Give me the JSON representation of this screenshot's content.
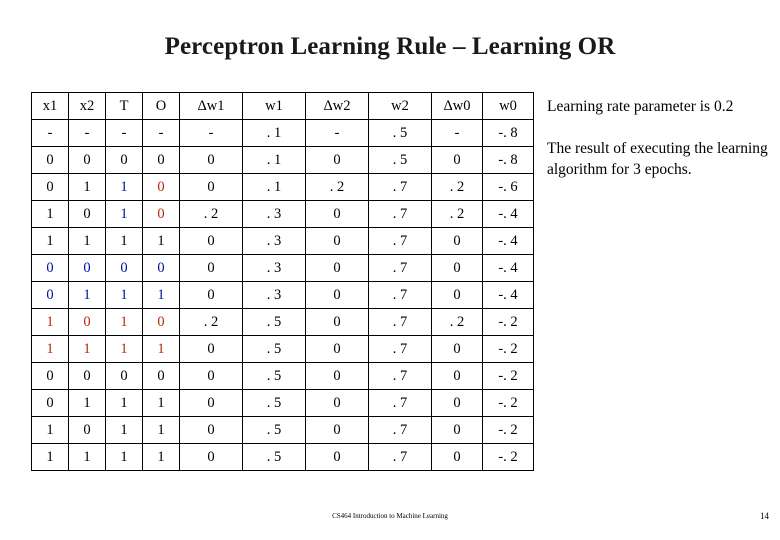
{
  "slide": {
    "title": "Perceptron Learning Rule – Learning OR",
    "footer_center": "CS464 Introduction to Machine Learning",
    "footer_page": "14"
  },
  "table": {
    "headers": [
      {
        "text": "x1",
        "color": "black"
      },
      {
        "text": "x2",
        "color": "black"
      },
      {
        "text": "T",
        "color": "black"
      },
      {
        "text": "O",
        "color": "black"
      },
      {
        "text": "Δw1",
        "color": "black"
      },
      {
        "text": "w1",
        "color": "black"
      },
      {
        "text": "Δw2",
        "color": "black"
      },
      {
        "text": "w2",
        "color": "black"
      },
      {
        "text": "Δw0",
        "color": "black"
      },
      {
        "text": "w0",
        "color": "black"
      }
    ],
    "rows": [
      [
        {
          "text": "-",
          "color": "black"
        },
        {
          "text": "-",
          "color": "black"
        },
        {
          "text": "-",
          "color": "black"
        },
        {
          "text": "-",
          "color": "black"
        },
        {
          "text": "-",
          "color": "black"
        },
        {
          "text": ". 1",
          "color": "black"
        },
        {
          "text": "-",
          "color": "black"
        },
        {
          "text": ". 5",
          "color": "black"
        },
        {
          "text": "-",
          "color": "black"
        },
        {
          "text": "-. 8",
          "color": "black"
        }
      ],
      [
        {
          "text": "0",
          "color": "black"
        },
        {
          "text": "0",
          "color": "black"
        },
        {
          "text": "0",
          "color": "black"
        },
        {
          "text": "0",
          "color": "black"
        },
        {
          "text": "0",
          "color": "black"
        },
        {
          "text": ". 1",
          "color": "black"
        },
        {
          "text": "0",
          "color": "black"
        },
        {
          "text": ". 5",
          "color": "black"
        },
        {
          "text": "0",
          "color": "black"
        },
        {
          "text": "-. 8",
          "color": "black"
        }
      ],
      [
        {
          "text": "0",
          "color": "black"
        },
        {
          "text": "1",
          "color": "black"
        },
        {
          "text": "1",
          "color": "blue"
        },
        {
          "text": "0",
          "color": "red"
        },
        {
          "text": "0",
          "color": "black"
        },
        {
          "text": ". 1",
          "color": "black"
        },
        {
          "text": ". 2",
          "color": "black"
        },
        {
          "text": ". 7",
          "color": "black"
        },
        {
          "text": ". 2",
          "color": "black"
        },
        {
          "text": "-. 6",
          "color": "black"
        }
      ],
      [
        {
          "text": "1",
          "color": "black"
        },
        {
          "text": "0",
          "color": "black"
        },
        {
          "text": "1",
          "color": "blue"
        },
        {
          "text": "0",
          "color": "red"
        },
        {
          "text": ". 2",
          "color": "black"
        },
        {
          "text": ". 3",
          "color": "black"
        },
        {
          "text": "0",
          "color": "black"
        },
        {
          "text": ". 7",
          "color": "black"
        },
        {
          "text": ". 2",
          "color": "black"
        },
        {
          "text": "-. 4",
          "color": "black"
        }
      ],
      [
        {
          "text": "1",
          "color": "black"
        },
        {
          "text": "1",
          "color": "black"
        },
        {
          "text": "1",
          "color": "black"
        },
        {
          "text": "1",
          "color": "black"
        },
        {
          "text": "0",
          "color": "black"
        },
        {
          "text": ". 3",
          "color": "black"
        },
        {
          "text": "0",
          "color": "black"
        },
        {
          "text": ". 7",
          "color": "black"
        },
        {
          "text": "0",
          "color": "black"
        },
        {
          "text": "-. 4",
          "color": "black"
        }
      ],
      [
        {
          "text": "0",
          "color": "blue"
        },
        {
          "text": "0",
          "color": "blue"
        },
        {
          "text": "0",
          "color": "blue"
        },
        {
          "text": "0",
          "color": "blue"
        },
        {
          "text": "0",
          "color": "black"
        },
        {
          "text": ". 3",
          "color": "black"
        },
        {
          "text": "0",
          "color": "black"
        },
        {
          "text": ". 7",
          "color": "black"
        },
        {
          "text": "0",
          "color": "black"
        },
        {
          "text": "-. 4",
          "color": "black"
        }
      ],
      [
        {
          "text": "0",
          "color": "blue"
        },
        {
          "text": "1",
          "color": "blue"
        },
        {
          "text": "1",
          "color": "blue"
        },
        {
          "text": "1",
          "color": "blue"
        },
        {
          "text": "0",
          "color": "black"
        },
        {
          "text": ". 3",
          "color": "black"
        },
        {
          "text": "0",
          "color": "black"
        },
        {
          "text": ". 7",
          "color": "black"
        },
        {
          "text": "0",
          "color": "black"
        },
        {
          "text": "-. 4",
          "color": "black"
        }
      ],
      [
        {
          "text": "1",
          "color": "red"
        },
        {
          "text": "0",
          "color": "red"
        },
        {
          "text": "1",
          "color": "red"
        },
        {
          "text": "0",
          "color": "red"
        },
        {
          "text": ". 2",
          "color": "black"
        },
        {
          "text": ". 5",
          "color": "black"
        },
        {
          "text": "0",
          "color": "black"
        },
        {
          "text": ". 7",
          "color": "black"
        },
        {
          "text": ". 2",
          "color": "black"
        },
        {
          "text": "-. 2",
          "color": "black"
        }
      ],
      [
        {
          "text": "1",
          "color": "red"
        },
        {
          "text": "1",
          "color": "red"
        },
        {
          "text": "1",
          "color": "red"
        },
        {
          "text": "1",
          "color": "red"
        },
        {
          "text": "0",
          "color": "black"
        },
        {
          "text": ". 5",
          "color": "black"
        },
        {
          "text": "0",
          "color": "black"
        },
        {
          "text": ". 7",
          "color": "black"
        },
        {
          "text": "0",
          "color": "black"
        },
        {
          "text": "-. 2",
          "color": "black"
        }
      ],
      [
        {
          "text": "0",
          "color": "black"
        },
        {
          "text": "0",
          "color": "black"
        },
        {
          "text": "0",
          "color": "black"
        },
        {
          "text": "0",
          "color": "black"
        },
        {
          "text": "0",
          "color": "black"
        },
        {
          "text": ". 5",
          "color": "black"
        },
        {
          "text": "0",
          "color": "black"
        },
        {
          "text": ". 7",
          "color": "black"
        },
        {
          "text": "0",
          "color": "black"
        },
        {
          "text": "-. 2",
          "color": "black"
        }
      ],
      [
        {
          "text": "0",
          "color": "black"
        },
        {
          "text": "1",
          "color": "black"
        },
        {
          "text": "1",
          "color": "black"
        },
        {
          "text": "1",
          "color": "black"
        },
        {
          "text": "0",
          "color": "black"
        },
        {
          "text": ". 5",
          "color": "black"
        },
        {
          "text": "0",
          "color": "black"
        },
        {
          "text": ". 7",
          "color": "black"
        },
        {
          "text": "0",
          "color": "black"
        },
        {
          "text": "-. 2",
          "color": "black"
        }
      ],
      [
        {
          "text": "1",
          "color": "black"
        },
        {
          "text": "0",
          "color": "black"
        },
        {
          "text": "1",
          "color": "black"
        },
        {
          "text": "1",
          "color": "black"
        },
        {
          "text": "0",
          "color": "black"
        },
        {
          "text": ". 5",
          "color": "black"
        },
        {
          "text": "0",
          "color": "black"
        },
        {
          "text": ". 7",
          "color": "black"
        },
        {
          "text": "0",
          "color": "black"
        },
        {
          "text": "-. 2",
          "color": "black"
        }
      ],
      [
        {
          "text": "1",
          "color": "black"
        },
        {
          "text": "1",
          "color": "black"
        },
        {
          "text": "1",
          "color": "black"
        },
        {
          "text": "1",
          "color": "black"
        },
        {
          "text": "0",
          "color": "black"
        },
        {
          "text": ". 5",
          "color": "black"
        },
        {
          "text": "0",
          "color": "black"
        },
        {
          "text": ". 7",
          "color": "black"
        },
        {
          "text": "0",
          "color": "black"
        },
        {
          "text": "-. 2",
          "color": "black"
        }
      ]
    ]
  },
  "notes": {
    "paragraph1": "Learning rate parameter is 0.2",
    "paragraph2": "The result of executing the learning algorithm for 3 epochs."
  }
}
